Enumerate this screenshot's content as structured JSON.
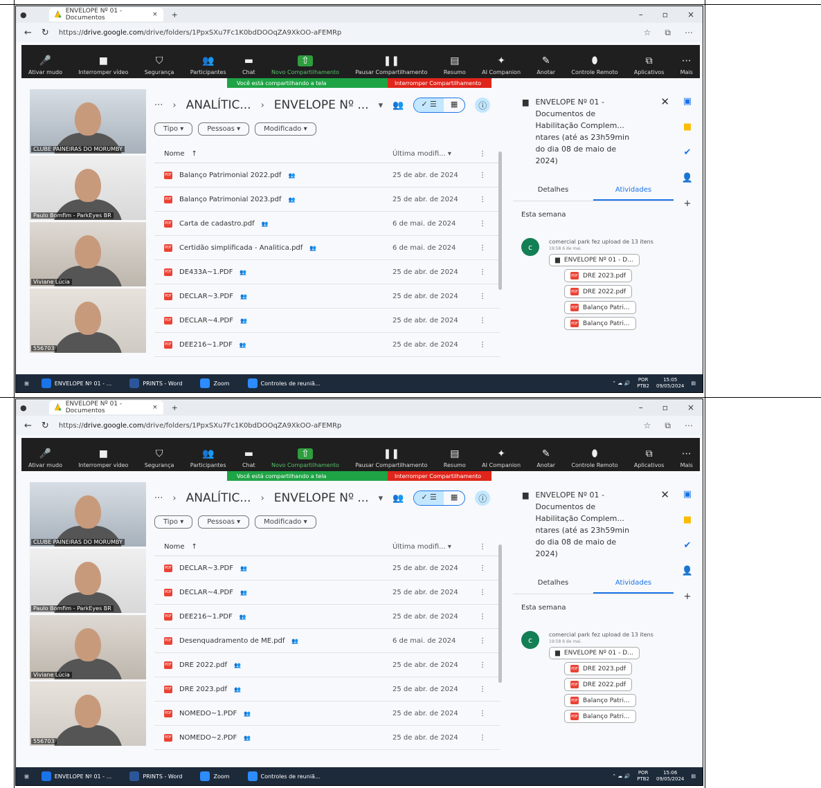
{
  "browser": {
    "tab_title": "ENVELOPE Nº 01 - Documentos",
    "url_prefix": "https://",
    "url_domain": "drive.google.com",
    "url_path": "/drive/folders/1PpxSXu7Fc1K0bdDOOqZA9XkOO-aFEMRp"
  },
  "zoom_toolbar": {
    "items": [
      "Ativar mudo",
      "Interromper vídeo",
      "Segurança",
      "Participantes",
      "Chat",
      "Novo Compartilhamento",
      "Pausar Compartilhamento",
      "Resumo",
      "AI Companion",
      "Anotar",
      "Controle Remoto",
      "Aplicativos",
      "Mais"
    ],
    "participants_count": "4",
    "sharing_msg": "Você está compartilhando a tela",
    "stop_share": "Interromper Compartilhamento"
  },
  "videos": [
    {
      "name": "CLUBE PAINEIRAS DO MORUMBY"
    },
    {
      "name": "Paulo Bomfim - ParkEyes BR"
    },
    {
      "name": "Viviane Lúcia"
    },
    {
      "name": "556703"
    }
  ],
  "drive": {
    "crumb_root": "ANALÍTIC...",
    "crumb_current": "ENVELOPE Nº ...",
    "filters": [
      "Tipo",
      "Pessoas",
      "Modificado"
    ],
    "col_name": "Nome",
    "col_modified": "Última modifi...",
    "detail": {
      "title_lines": [
        "ENVELOPE Nº 01 -",
        "Documentos de",
        "Habilitação Complem...",
        "ntares (até as 23h59min",
        "do dia 08 de maio de",
        "2024)"
      ],
      "tab_details": "Detalhes",
      "tab_activity": "Atividades",
      "week": "Esta semana",
      "avatar_letter": "c",
      "activity_text": "comercial park fez upload de 13 itens",
      "activity_time": "19:58 6 de mai.",
      "chips": [
        "ENVELOPE Nº 01 - D...",
        "DRE 2023.pdf",
        "DRE 2022.pdf",
        "Balanço Patri...",
        "Balanço Patri..."
      ]
    }
  },
  "screens": [
    {
      "files": [
        {
          "name": "Balanço Patrimonial 2022.pdf",
          "date": "25 de abr. de 2024"
        },
        {
          "name": "Balanço Patrimonial 2023.pdf",
          "date": "25 de abr. de 2024"
        },
        {
          "name": "Carta de cadastro.pdf",
          "date": "6 de mai. de 2024"
        },
        {
          "name": "Certidão simplificada - Analitica.pdf",
          "date": "6 de mai. de 2024"
        },
        {
          "name": "DE433A~1.PDF",
          "date": "25 de abr. de 2024"
        },
        {
          "name": "DECLAR~3.PDF",
          "date": "25 de abr. de 2024"
        },
        {
          "name": "DECLAR~4.PDF",
          "date": "25 de abr. de 2024"
        },
        {
          "name": "DEE216~1.PDF",
          "date": "25 de abr. de 2024"
        }
      ],
      "clock_time": "15:05",
      "clock_date": "09/05/2024"
    },
    {
      "files": [
        {
          "name": "DECLAR~3.PDF",
          "date": "25 de abr. de 2024"
        },
        {
          "name": "DECLAR~4.PDF",
          "date": "25 de abr. de 2024"
        },
        {
          "name": "DEE216~1.PDF",
          "date": "25 de abr. de 2024"
        },
        {
          "name": "Desenquadramento de ME.pdf",
          "date": "6 de mai. de 2024"
        },
        {
          "name": "DRE 2022.pdf",
          "date": "25 de abr. de 2024"
        },
        {
          "name": "DRE 2023.pdf",
          "date": "25 de abr. de 2024"
        },
        {
          "name": "NOMEDO~1.PDF",
          "date": "25 de abr. de 2024"
        },
        {
          "name": "NOMEDO~2.PDF",
          "date": "25 de abr. de 2024"
        }
      ],
      "clock_time": "15:06",
      "clock_date": "09/05/2024"
    }
  ],
  "taskbar": {
    "items": [
      "ENVELOPE Nº 01 - ...",
      "PRINTS - Word",
      "Zoom",
      "Controles de reuniã..."
    ],
    "lang": "POR",
    "layout": "PTB2"
  }
}
